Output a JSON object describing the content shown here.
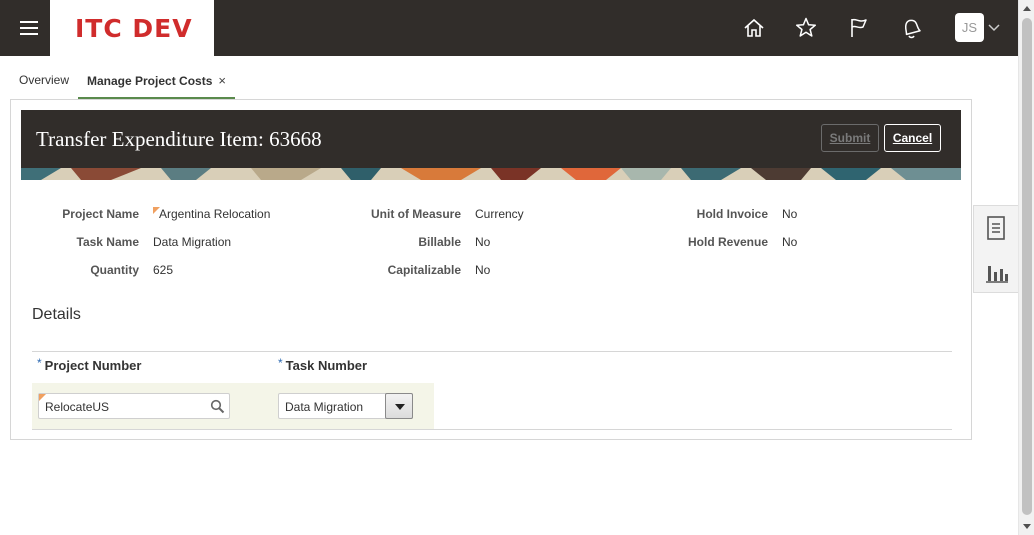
{
  "brand": {
    "logo_text": "ITC DEV",
    "logo_color": "#d02c2c",
    "topbar_color": "#312d2a"
  },
  "topbar": {
    "icons": [
      "home-icon",
      "favorites-star-icon",
      "watchlist-flag-icon",
      "notifications-bell-icon"
    ],
    "user_initials": "JS"
  },
  "tabs": [
    {
      "label": "Overview",
      "active": false
    },
    {
      "label": "Manage Project Costs",
      "active": true,
      "close": "×"
    }
  ],
  "page": {
    "title": "Transfer Expenditure Item: 63668",
    "submit_label": "Submit",
    "cancel_label": "Cancel"
  },
  "info": {
    "project_name_label": "Project Name",
    "project_name_value": "Argentina Relocation",
    "task_name_label": "Task Name",
    "task_name_value": "Data Migration",
    "quantity_label": "Quantity",
    "quantity_value": "625",
    "unit_of_measure_label": "Unit of Measure",
    "unit_of_measure_value": "Currency",
    "billable_label": "Billable",
    "billable_value": "No",
    "capitalizable_label": "Capitalizable",
    "capitalizable_value": "No",
    "hold_invoice_label": "Hold Invoice",
    "hold_invoice_value": "No",
    "hold_revenue_label": "Hold Revenue",
    "hold_revenue_value": "No"
  },
  "details": {
    "title": "Details",
    "required_marker": "*",
    "project_number_header": "Project Number",
    "task_number_header": "Task Number",
    "project_number_value": "RelocateUS",
    "task_number_value": "Data Migration"
  },
  "side_panel": {
    "icons": [
      "document-list-icon",
      "bar-chart-icon"
    ]
  }
}
